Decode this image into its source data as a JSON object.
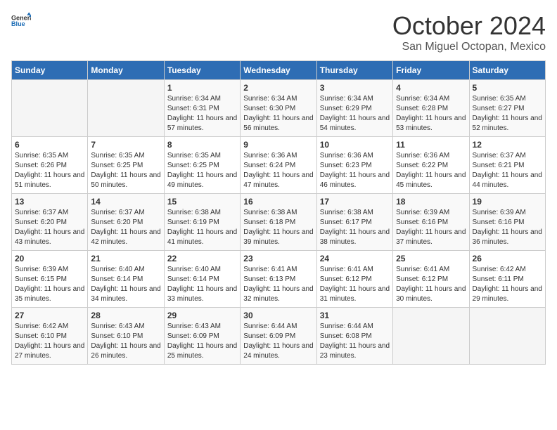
{
  "header": {
    "logo_general": "General",
    "logo_blue": "Blue",
    "month": "October 2024",
    "location": "San Miguel Octopan, Mexico"
  },
  "weekdays": [
    "Sunday",
    "Monday",
    "Tuesday",
    "Wednesday",
    "Thursday",
    "Friday",
    "Saturday"
  ],
  "weeks": [
    [
      {
        "day": "",
        "info": ""
      },
      {
        "day": "",
        "info": ""
      },
      {
        "day": "1",
        "info": "Sunrise: 6:34 AM\nSunset: 6:31 PM\nDaylight: 11 hours and 57 minutes."
      },
      {
        "day": "2",
        "info": "Sunrise: 6:34 AM\nSunset: 6:30 PM\nDaylight: 11 hours and 56 minutes."
      },
      {
        "day": "3",
        "info": "Sunrise: 6:34 AM\nSunset: 6:29 PM\nDaylight: 11 hours and 54 minutes."
      },
      {
        "day": "4",
        "info": "Sunrise: 6:34 AM\nSunset: 6:28 PM\nDaylight: 11 hours and 53 minutes."
      },
      {
        "day": "5",
        "info": "Sunrise: 6:35 AM\nSunset: 6:27 PM\nDaylight: 11 hours and 52 minutes."
      }
    ],
    [
      {
        "day": "6",
        "info": "Sunrise: 6:35 AM\nSunset: 6:26 PM\nDaylight: 11 hours and 51 minutes."
      },
      {
        "day": "7",
        "info": "Sunrise: 6:35 AM\nSunset: 6:25 PM\nDaylight: 11 hours and 50 minutes."
      },
      {
        "day": "8",
        "info": "Sunrise: 6:35 AM\nSunset: 6:25 PM\nDaylight: 11 hours and 49 minutes."
      },
      {
        "day": "9",
        "info": "Sunrise: 6:36 AM\nSunset: 6:24 PM\nDaylight: 11 hours and 47 minutes."
      },
      {
        "day": "10",
        "info": "Sunrise: 6:36 AM\nSunset: 6:23 PM\nDaylight: 11 hours and 46 minutes."
      },
      {
        "day": "11",
        "info": "Sunrise: 6:36 AM\nSunset: 6:22 PM\nDaylight: 11 hours and 45 minutes."
      },
      {
        "day": "12",
        "info": "Sunrise: 6:37 AM\nSunset: 6:21 PM\nDaylight: 11 hours and 44 minutes."
      }
    ],
    [
      {
        "day": "13",
        "info": "Sunrise: 6:37 AM\nSunset: 6:20 PM\nDaylight: 11 hours and 43 minutes."
      },
      {
        "day": "14",
        "info": "Sunrise: 6:37 AM\nSunset: 6:20 PM\nDaylight: 11 hours and 42 minutes."
      },
      {
        "day": "15",
        "info": "Sunrise: 6:38 AM\nSunset: 6:19 PM\nDaylight: 11 hours and 41 minutes."
      },
      {
        "day": "16",
        "info": "Sunrise: 6:38 AM\nSunset: 6:18 PM\nDaylight: 11 hours and 39 minutes."
      },
      {
        "day": "17",
        "info": "Sunrise: 6:38 AM\nSunset: 6:17 PM\nDaylight: 11 hours and 38 minutes."
      },
      {
        "day": "18",
        "info": "Sunrise: 6:39 AM\nSunset: 6:16 PM\nDaylight: 11 hours and 37 minutes."
      },
      {
        "day": "19",
        "info": "Sunrise: 6:39 AM\nSunset: 6:16 PM\nDaylight: 11 hours and 36 minutes."
      }
    ],
    [
      {
        "day": "20",
        "info": "Sunrise: 6:39 AM\nSunset: 6:15 PM\nDaylight: 11 hours and 35 minutes."
      },
      {
        "day": "21",
        "info": "Sunrise: 6:40 AM\nSunset: 6:14 PM\nDaylight: 11 hours and 34 minutes."
      },
      {
        "day": "22",
        "info": "Sunrise: 6:40 AM\nSunset: 6:14 PM\nDaylight: 11 hours and 33 minutes."
      },
      {
        "day": "23",
        "info": "Sunrise: 6:41 AM\nSunset: 6:13 PM\nDaylight: 11 hours and 32 minutes."
      },
      {
        "day": "24",
        "info": "Sunrise: 6:41 AM\nSunset: 6:12 PM\nDaylight: 11 hours and 31 minutes."
      },
      {
        "day": "25",
        "info": "Sunrise: 6:41 AM\nSunset: 6:12 PM\nDaylight: 11 hours and 30 minutes."
      },
      {
        "day": "26",
        "info": "Sunrise: 6:42 AM\nSunset: 6:11 PM\nDaylight: 11 hours and 29 minutes."
      }
    ],
    [
      {
        "day": "27",
        "info": "Sunrise: 6:42 AM\nSunset: 6:10 PM\nDaylight: 11 hours and 27 minutes."
      },
      {
        "day": "28",
        "info": "Sunrise: 6:43 AM\nSunset: 6:10 PM\nDaylight: 11 hours and 26 minutes."
      },
      {
        "day": "29",
        "info": "Sunrise: 6:43 AM\nSunset: 6:09 PM\nDaylight: 11 hours and 25 minutes."
      },
      {
        "day": "30",
        "info": "Sunrise: 6:44 AM\nSunset: 6:09 PM\nDaylight: 11 hours and 24 minutes."
      },
      {
        "day": "31",
        "info": "Sunrise: 6:44 AM\nSunset: 6:08 PM\nDaylight: 11 hours and 23 minutes."
      },
      {
        "day": "",
        "info": ""
      },
      {
        "day": "",
        "info": ""
      }
    ]
  ]
}
